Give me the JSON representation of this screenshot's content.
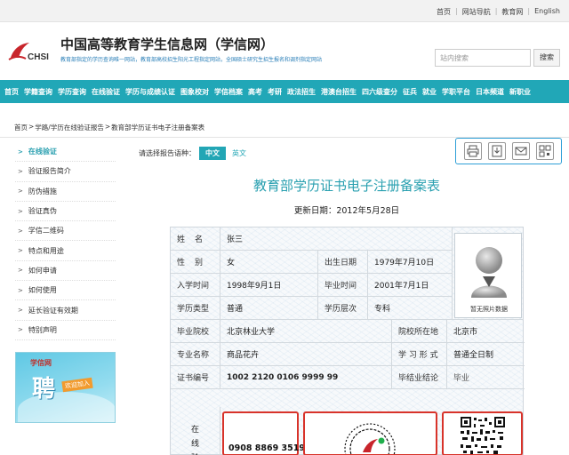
{
  "top_links": [
    "首页",
    "网站导航",
    "教育网",
    "English"
  ],
  "header": {
    "logo_text": "CHSI",
    "site_title": "中国高等教育学生信息网（学信网）",
    "site_subtitle": "教育部指定的学历查询唯一网站，教育部高校招生阳光工程指定网站，全国硕士研究生招生报名和调剂指定网站",
    "search_placeholder": "站内搜索",
    "search_button": "搜索"
  },
  "nav": [
    "首页",
    "学籍查询",
    "学历查询",
    "在线验证",
    "学历与成绩认证",
    "图象校对",
    "学信档案",
    "高考",
    "考研",
    "政法招生",
    "港澳台招生",
    "四六级查分",
    "征兵",
    "就业",
    "学职平台",
    "日本频道",
    "新职业"
  ],
  "breadcrumb": [
    "首页",
    "学路/学历在线验证报告",
    "教育部学历证书电子注册备案表"
  ],
  "sidebar": [
    {
      "label": "在线验证",
      "active": true
    },
    {
      "label": "验证报告简介",
      "active": false
    },
    {
      "label": "防伪措施",
      "active": false
    },
    {
      "label": "验证真伪",
      "active": false
    },
    {
      "label": "学信二维码",
      "active": false
    },
    {
      "label": "特点和用途",
      "active": false
    },
    {
      "label": "如何申请",
      "active": false
    },
    {
      "label": "如何使用",
      "active": false
    },
    {
      "label": "延长验证有效期",
      "active": false
    },
    {
      "label": "特别声明",
      "active": false
    }
  ],
  "banner": {
    "logo": "学信网",
    "main": "聘",
    "tag": "欢迎加入"
  },
  "lang": {
    "prompt": "请选择报告语种：",
    "active": "中文",
    "other": "英文"
  },
  "tool_icons": [
    "print-icon",
    "download-icon",
    "mail-icon",
    "qr-icon"
  ],
  "doc": {
    "title": "教育部学历证书电子注册备案表",
    "update": "更新日期：2012年5月28日"
  },
  "form": {
    "name_label": "姓名",
    "name_value": "张三",
    "gender_label": "性别",
    "gender_value": "女",
    "birth_label": "出生日期",
    "birth_value": "1979年7月10日",
    "admission_label": "入学时间",
    "admission_value": "1998年9月1日",
    "graduation_label": "毕业时间",
    "graduation_value": "2001年7月1日",
    "edutype_label": "学历类型",
    "edutype_value": "普通",
    "level_label": "学历层次",
    "level_value": "专科",
    "school_label": "毕业院校",
    "school_value": "北京林业大学",
    "location_label": "院校所在地",
    "location_value": "北京市",
    "major_label": "专业名称",
    "major_value": "商品花卉",
    "mode_label": "学 习 形 式",
    "mode_value": "普通全日制",
    "cert_label": "证书编号",
    "cert_value": "1002 2120 0106 9999 99",
    "conclusion_label": "毕结业结论",
    "conclusion_value": "毕业",
    "photo_caption": "暂无照片数据",
    "verify_chars": [
      "在",
      "线",
      "验"
    ],
    "verify_code": "0908 8869 3519"
  }
}
